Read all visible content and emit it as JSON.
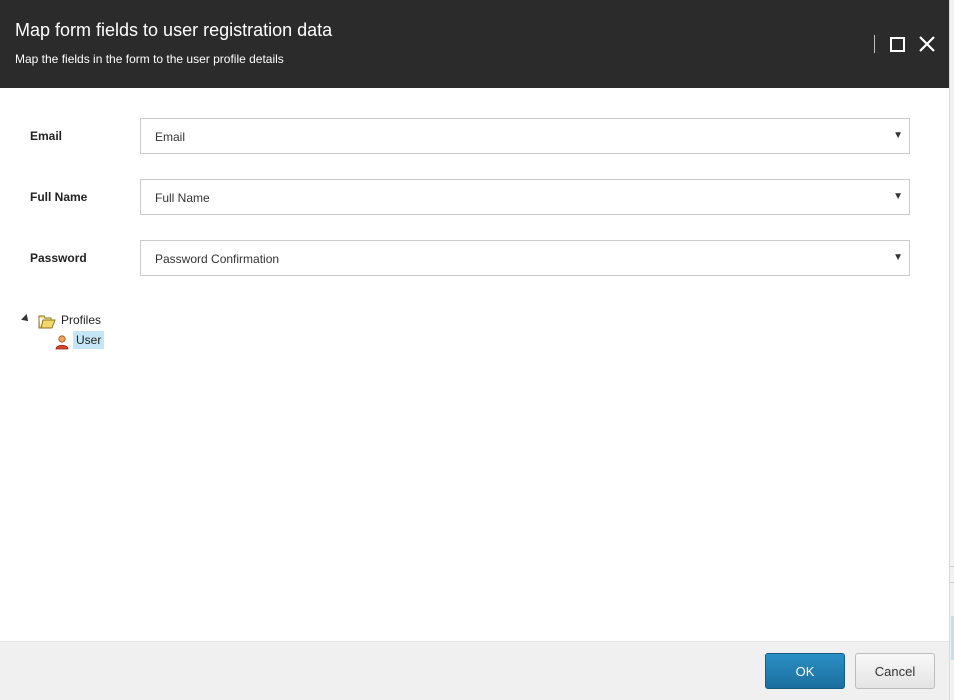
{
  "dialog": {
    "title": "Map form fields to user registration data",
    "subtitle": "Map the fields in the form to the user profile details"
  },
  "fields": [
    {
      "label": "Email",
      "value": "Email"
    },
    {
      "label": "Full Name",
      "value": "Full Name"
    },
    {
      "label": "Password",
      "value": "Password Confirmation"
    }
  ],
  "tree": {
    "root": {
      "label": "Profiles",
      "icon": "folder-icon",
      "expanded": true
    },
    "children": [
      {
        "label": "User",
        "icon": "user-icon",
        "selected": true
      }
    ]
  },
  "footer": {
    "ok_label": "OK",
    "cancel_label": "Cancel"
  },
  "colors": {
    "header_bg": "#2b2b2b",
    "primary_button": "#1f7bb0",
    "selection_bg": "#c5e6f6"
  }
}
